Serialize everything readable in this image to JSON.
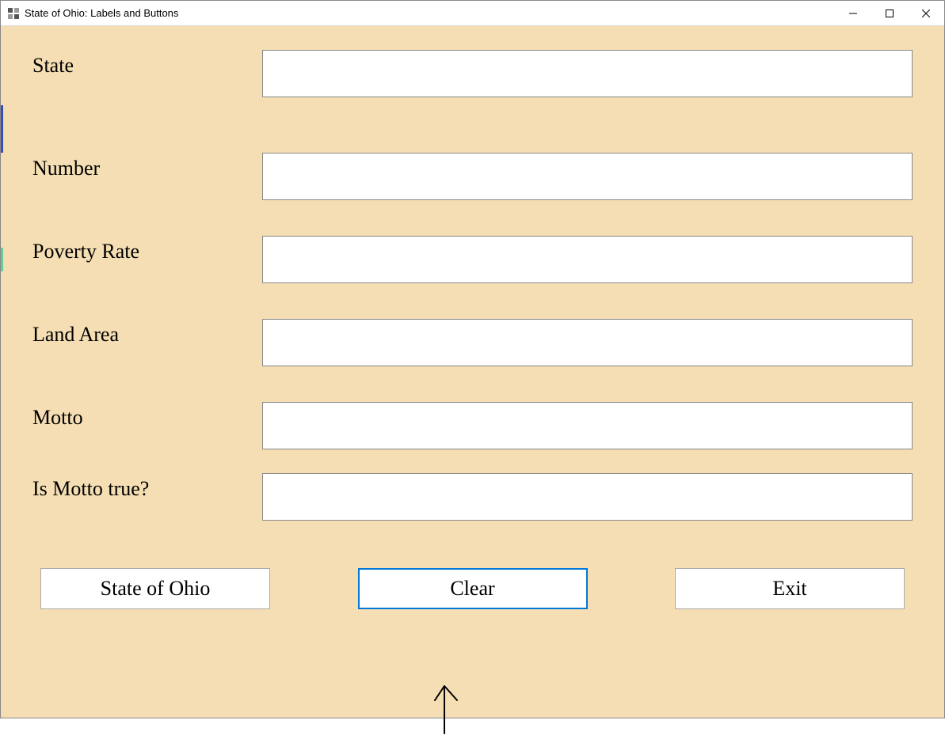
{
  "window": {
    "title": "State of Ohio: Labels and Buttons"
  },
  "fields": {
    "state": {
      "label": "State",
      "value": ""
    },
    "number": {
      "label": "Number",
      "value": ""
    },
    "poverty_rate": {
      "label": "Poverty Rate",
      "value": ""
    },
    "land_area": {
      "label": "Land Area",
      "value": ""
    },
    "motto": {
      "label": "Motto",
      "value": ""
    },
    "is_motto_true": {
      "label": "Is Motto true?",
      "value": ""
    }
  },
  "buttons": {
    "state_of_ohio": "State of Ohio",
    "clear": "Clear",
    "exit": "Exit"
  }
}
